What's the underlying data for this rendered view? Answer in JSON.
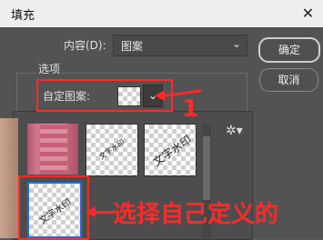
{
  "window": {
    "title": "填充"
  },
  "content_row": {
    "label": "内容(D):",
    "selected": "图案"
  },
  "buttons": {
    "ok": "确定",
    "cancel": "取消"
  },
  "options": {
    "group_label": "选项",
    "pattern_label": "自定图案:"
  },
  "pattern_tiles": [
    {
      "text": "文字水印"
    },
    {
      "text": "文字水印"
    },
    {
      "text": "文字水印"
    }
  ],
  "annotations": {
    "step_number": "1",
    "instruction": "选择自己定义的"
  },
  "colors": {
    "accent_red": "#ff2a2a",
    "dialog_bg": "#535353"
  }
}
